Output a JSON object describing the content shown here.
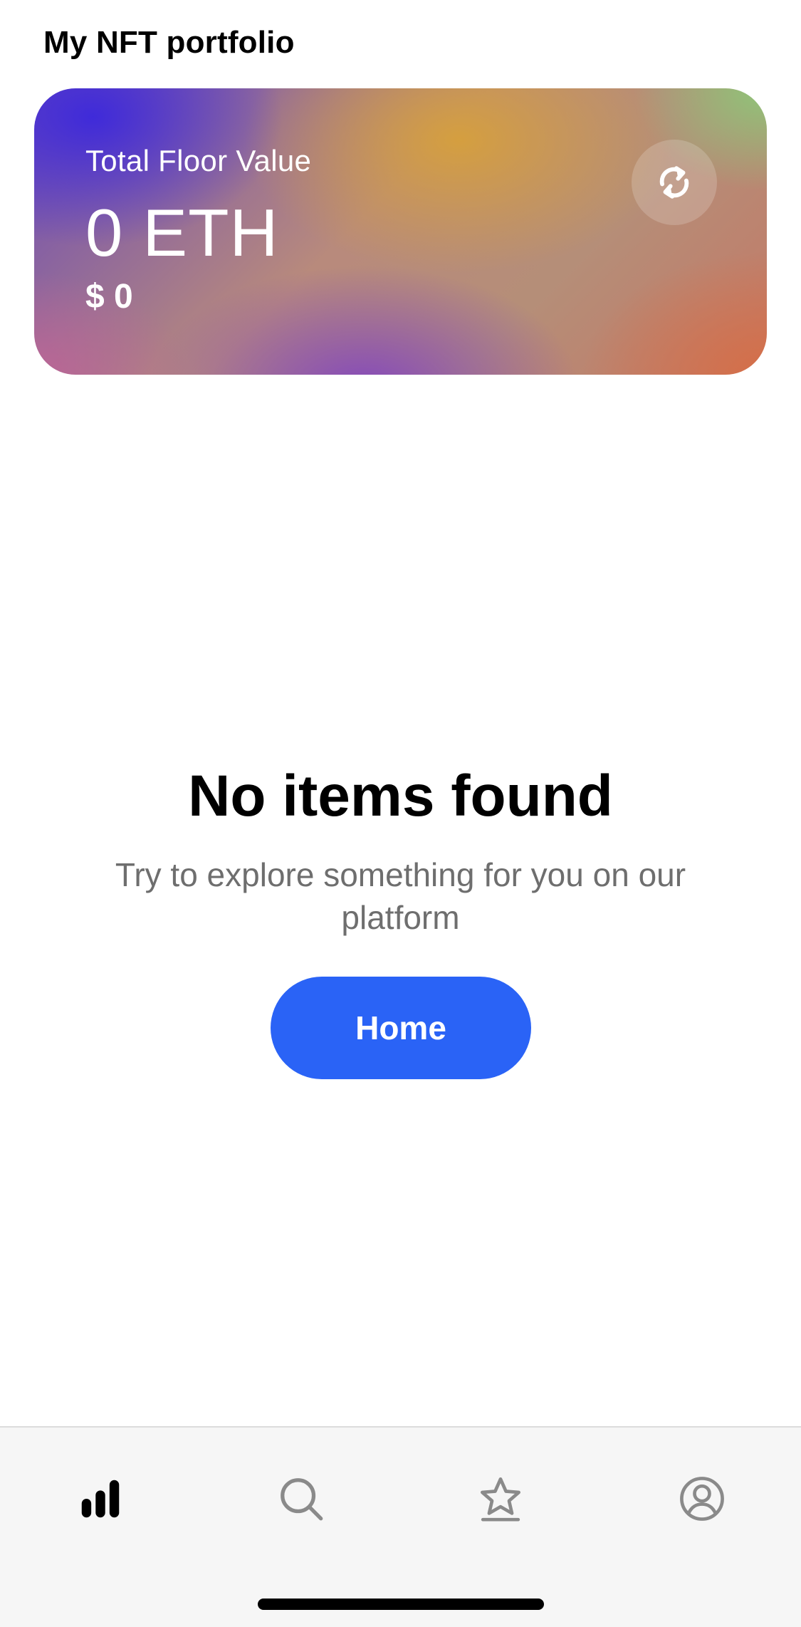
{
  "header": {
    "title": "My NFT portfolio"
  },
  "value_card": {
    "label": "Total Floor Value",
    "eth_value": "0 ETH",
    "usd_value": "$ 0",
    "refresh_icon": "refresh-icon"
  },
  "empty_state": {
    "title": "No items found",
    "subtitle": "Try to explore something for you on our platform",
    "button_label": "Home"
  },
  "tab_bar": {
    "items": [
      {
        "icon": "bar-chart-icon",
        "active": true
      },
      {
        "icon": "search-icon",
        "active": false
      },
      {
        "icon": "star-icon",
        "active": false
      },
      {
        "icon": "profile-icon",
        "active": false
      }
    ]
  },
  "colors": {
    "accent": "#2a63f6",
    "active_tab": "#000000",
    "inactive_tab": "#8a8a8a",
    "subtitle_text": "#6e6e6e"
  }
}
